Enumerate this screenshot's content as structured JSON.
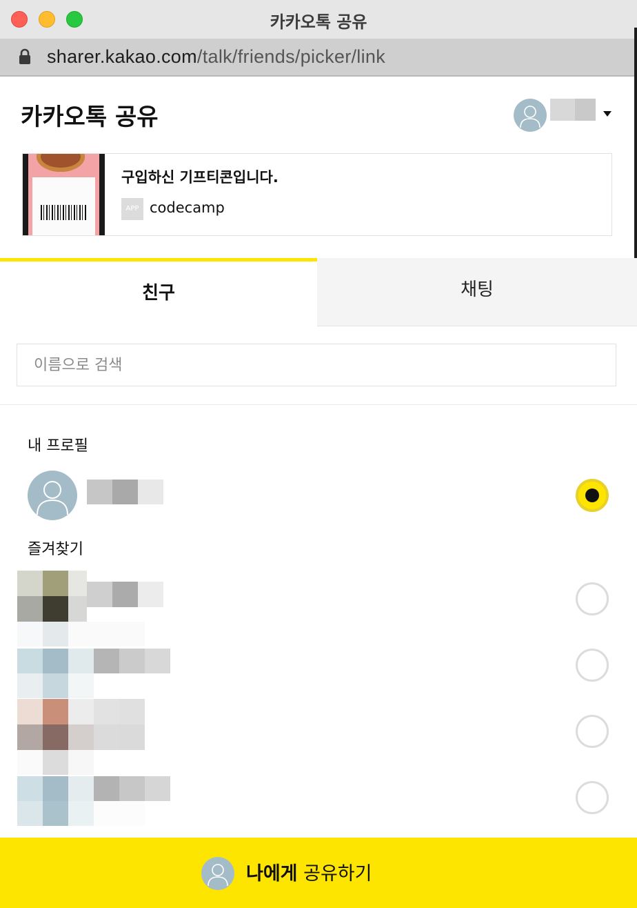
{
  "window": {
    "title": "카카오톡 공유",
    "url_host": "sharer.kakao.com",
    "url_path": "/talk/friends/picker/link"
  },
  "header": {
    "title": "카카오톡 공유",
    "account_icon": "user-avatar-icon",
    "dropdown_icon": "caret-down-icon"
  },
  "share_card": {
    "title": "구입하신 기프티콘입니다.",
    "app_badge": "APP",
    "app_name": "codecamp"
  },
  "tabs": [
    {
      "label": "친구",
      "active": true
    },
    {
      "label": "채팅",
      "active": false
    }
  ],
  "search": {
    "placeholder": "이름으로 검색",
    "value": ""
  },
  "sections": {
    "my_profile": "내 프로필",
    "favorites": "즐겨찾기"
  },
  "my_profile": {
    "selected": true
  },
  "favorites": [
    {
      "selected": false
    },
    {
      "selected": false
    },
    {
      "selected": false
    },
    {
      "selected": false
    }
  ],
  "footer": {
    "label_bold": "나에게",
    "label_rest": " 공유하기"
  },
  "colors": {
    "accent": "#fee500",
    "avatar_bg": "#a3bcc7",
    "tab_inactive_bg": "#f4f4f4"
  }
}
